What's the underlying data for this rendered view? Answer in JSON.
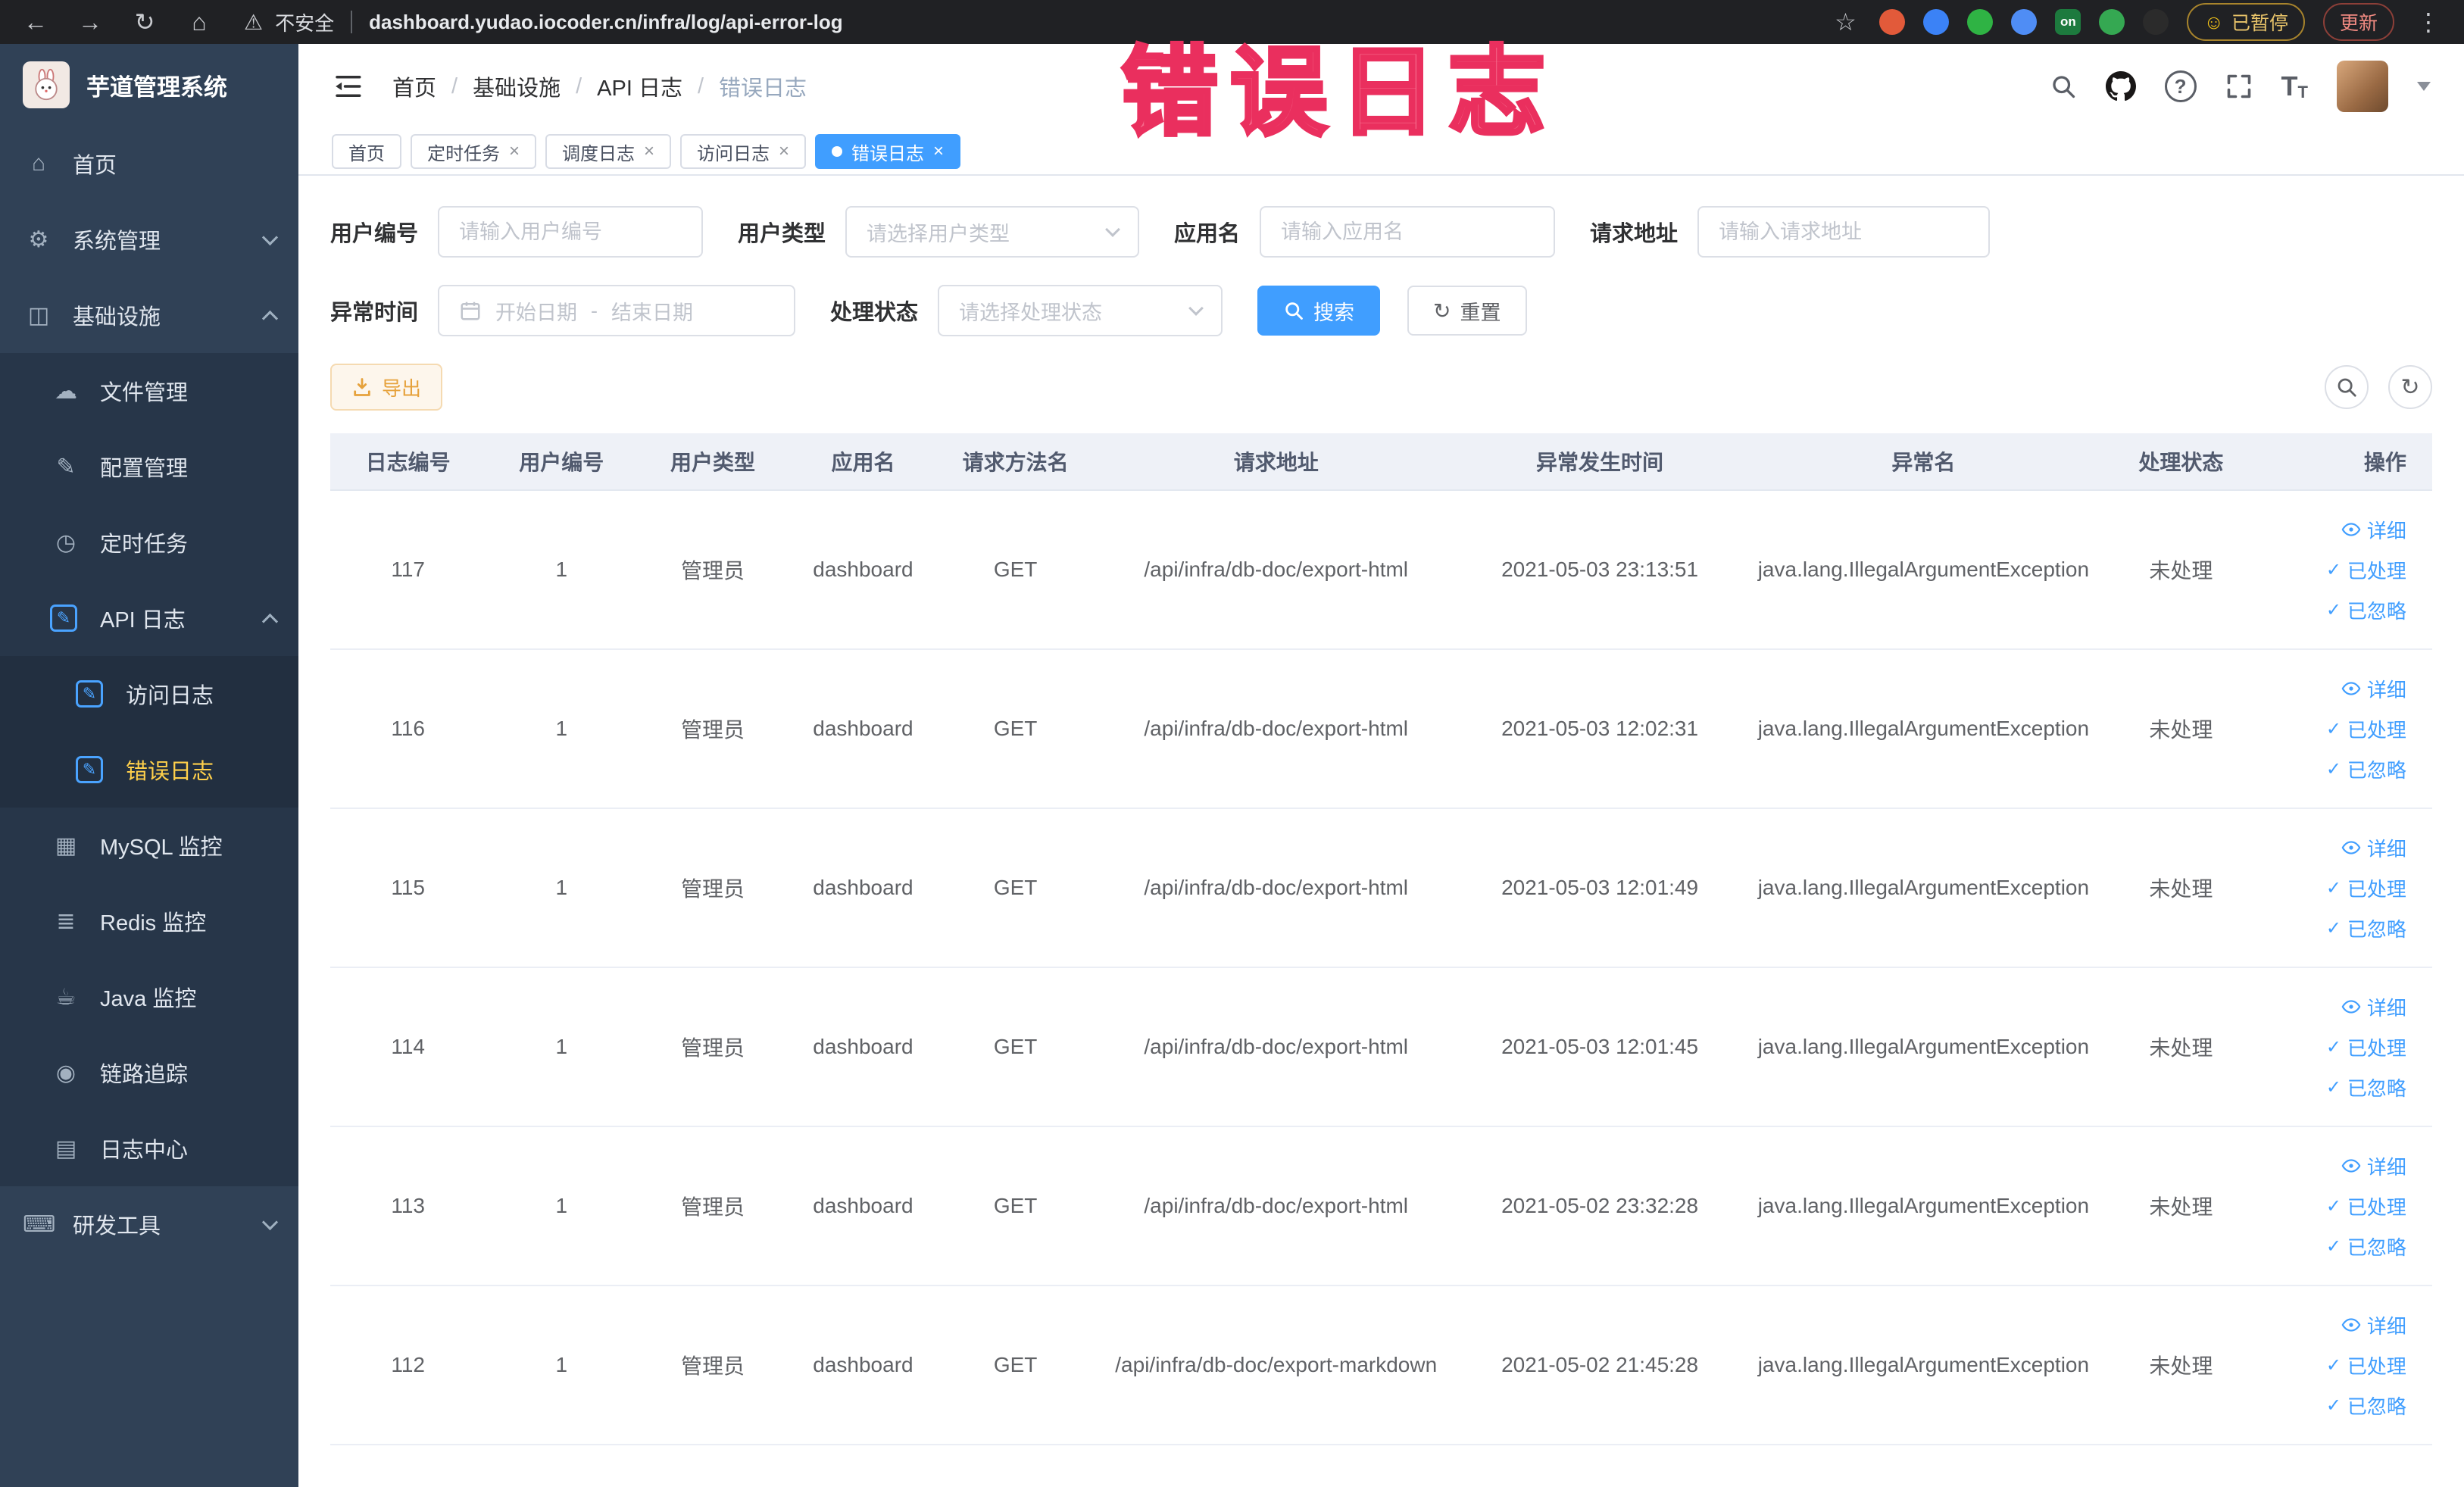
{
  "browser": {
    "security": "不安全",
    "url": "dashboard.yudao.iocoder.cn/infra/log/api-error-log",
    "on_badge": "on",
    "paused": "已暂停",
    "update": "更新"
  },
  "annotation": "错误日志",
  "sidebar": {
    "logo": "芋道管理系统",
    "items": [
      {
        "label": "首页"
      },
      {
        "label": "系统管理"
      },
      {
        "label": "基础设施"
      },
      {
        "label": "文件管理"
      },
      {
        "label": "配置管理"
      },
      {
        "label": "定时任务"
      },
      {
        "label": "API 日志"
      },
      {
        "label": "访问日志"
      },
      {
        "label": "错误日志"
      },
      {
        "label": "MySQL 监控"
      },
      {
        "label": "Redis 监控"
      },
      {
        "label": "Java 监控"
      },
      {
        "label": "链路追踪"
      },
      {
        "label": "日志中心"
      },
      {
        "label": "研发工具"
      }
    ]
  },
  "breadcrumb": {
    "separator": "/",
    "items": [
      "首页",
      "基础设施",
      "API 日志",
      "错误日志"
    ]
  },
  "tabs": [
    {
      "label": "首页"
    },
    {
      "label": "定时任务"
    },
    {
      "label": "调度日志"
    },
    {
      "label": "访问日志"
    },
    {
      "label": "错误日志"
    }
  ],
  "filters": {
    "user_id": {
      "label": "用户编号",
      "placeholder": "请输入用户编号"
    },
    "user_type": {
      "label": "用户类型",
      "placeholder": "请选择用户类型"
    },
    "app_name": {
      "label": "应用名",
      "placeholder": "请输入应用名"
    },
    "request_url": {
      "label": "请求地址",
      "placeholder": "请输入请求地址"
    },
    "exception_time": {
      "label": "异常时间",
      "start_placeholder": "开始日期",
      "separator": "-",
      "end_placeholder": "结束日期"
    },
    "process_status": {
      "label": "处理状态",
      "placeholder": "请选择处理状态"
    },
    "search": "搜索",
    "reset": "重置"
  },
  "toolbar": {
    "export": "导出"
  },
  "table": {
    "columns": [
      "日志编号",
      "用户编号",
      "用户类型",
      "应用名",
      "请求方法名",
      "请求地址",
      "异常发生时间",
      "异常名",
      "处理状态",
      "操作"
    ],
    "rows": [
      {
        "log_id": "117",
        "user_id": "1",
        "user_type": "管理员",
        "app_name": "dashboard",
        "method": "GET",
        "url": "/api/infra/db-doc/export-html",
        "time": "2021-05-03 23:13:51",
        "exception": "java.lang.IllegalArgumentException",
        "status": "未处理"
      },
      {
        "log_id": "116",
        "user_id": "1",
        "user_type": "管理员",
        "app_name": "dashboard",
        "method": "GET",
        "url": "/api/infra/db-doc/export-html",
        "time": "2021-05-03 12:02:31",
        "exception": "java.lang.IllegalArgumentException",
        "status": "未处理"
      },
      {
        "log_id": "115",
        "user_id": "1",
        "user_type": "管理员",
        "app_name": "dashboard",
        "method": "GET",
        "url": "/api/infra/db-doc/export-html",
        "time": "2021-05-03 12:01:49",
        "exception": "java.lang.IllegalArgumentException",
        "status": "未处理"
      },
      {
        "log_id": "114",
        "user_id": "1",
        "user_type": "管理员",
        "app_name": "dashboard",
        "method": "GET",
        "url": "/api/infra/db-doc/export-html",
        "time": "2021-05-03 12:01:45",
        "exception": "java.lang.IllegalArgumentException",
        "status": "未处理"
      },
      {
        "log_id": "113",
        "user_id": "1",
        "user_type": "管理员",
        "app_name": "dashboard",
        "method": "GET",
        "url": "/api/infra/db-doc/export-html",
        "time": "2021-05-02 23:32:28",
        "exception": "java.lang.IllegalArgumentException",
        "status": "未处理"
      },
      {
        "log_id": "112",
        "user_id": "1",
        "user_type": "管理员",
        "app_name": "dashboard",
        "method": "GET",
        "url": "/api/infra/db-doc/export-markdown",
        "time": "2021-05-02 21:45:28",
        "exception": "java.lang.IllegalArgumentException",
        "status": "未处理"
      }
    ],
    "actions": {
      "detail": "详细",
      "processed": "已处理",
      "ignored": "已忽略"
    }
  },
  "icons": {
    "back": "←",
    "forward": "→",
    "refresh": "↻",
    "home": "⌂",
    "warning": "⚠",
    "star": "☆",
    "kebab": "⋮",
    "smiley": "☺",
    "close": "×",
    "question": "?",
    "gear": "⚙",
    "infra": "◫",
    "cloud": "☁",
    "pencil": "✎",
    "clock": "◷",
    "grid": "▦",
    "stack": "≣",
    "coffee": "☕",
    "eye": "◉",
    "rows": "▤",
    "keyboard": "⌨",
    "check": "✓",
    "font_size": "T"
  },
  "colors": {
    "primary": "#409eff",
    "sidebar_bg": "#304156",
    "sidebar_active_text": "#ffd04b",
    "annotation_red": "#ea2f5e",
    "table_header_bg": "#eef1f7",
    "export_text": "#e6a23c",
    "chrome_bg": "#202124",
    "link_blue": "#409eff"
  }
}
